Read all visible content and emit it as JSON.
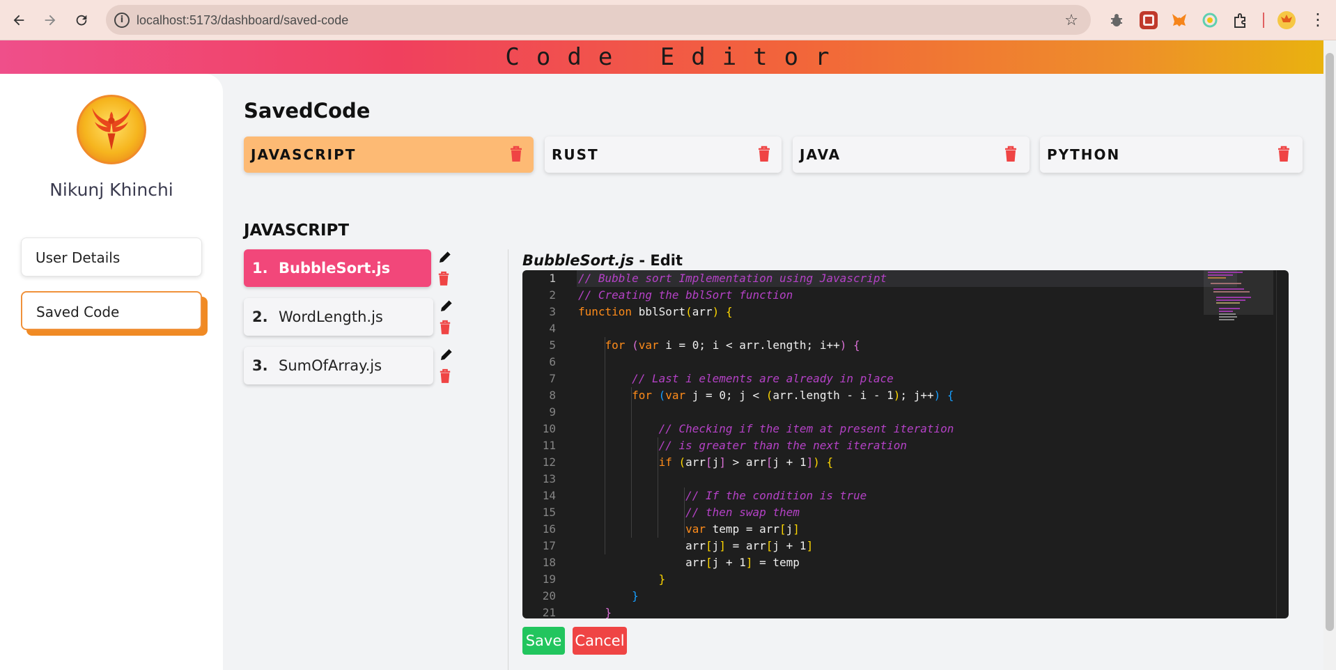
{
  "browser": {
    "url": "localhost:5173/dashboard/saved-code"
  },
  "app": {
    "title": "Code Editor"
  },
  "sidebar": {
    "user_name": "Nikunj Khinchi",
    "items": [
      {
        "label": "User Details",
        "active": false
      },
      {
        "label": "Saved Code",
        "active": true
      }
    ]
  },
  "main": {
    "title": "SavedCode",
    "languages": [
      {
        "label": "JAVASCRIPT",
        "active": true
      },
      {
        "label": "RUST",
        "active": false
      },
      {
        "label": "JAVA",
        "active": false
      },
      {
        "label": "PYTHON",
        "active": false
      }
    ],
    "section_title": "JAVASCRIPT",
    "files": [
      {
        "num": "1.",
        "name": "BubbleSort.js",
        "active": true
      },
      {
        "num": "2.",
        "name": "WordLength.js",
        "active": false
      },
      {
        "num": "3.",
        "name": "SumOfArray.js",
        "active": false
      }
    ],
    "editor": {
      "file_name": "BubbleSort.js",
      "suffix": " - Edit",
      "current_line": 1,
      "line_numbers": [
        "1",
        "2",
        "3",
        "4",
        "5",
        "6",
        "7",
        "8",
        "9",
        "10",
        "11",
        "12",
        "13",
        "14",
        "15",
        "16",
        "17",
        "18",
        "19",
        "20",
        "21"
      ],
      "save_label": "Save",
      "cancel_label": "Cancel"
    }
  },
  "colors": {
    "accent_orange": "#f08a24",
    "active_file": "#f2477a",
    "active_language": "#fdba74",
    "save": "#22c55e",
    "cancel": "#ef4444"
  }
}
